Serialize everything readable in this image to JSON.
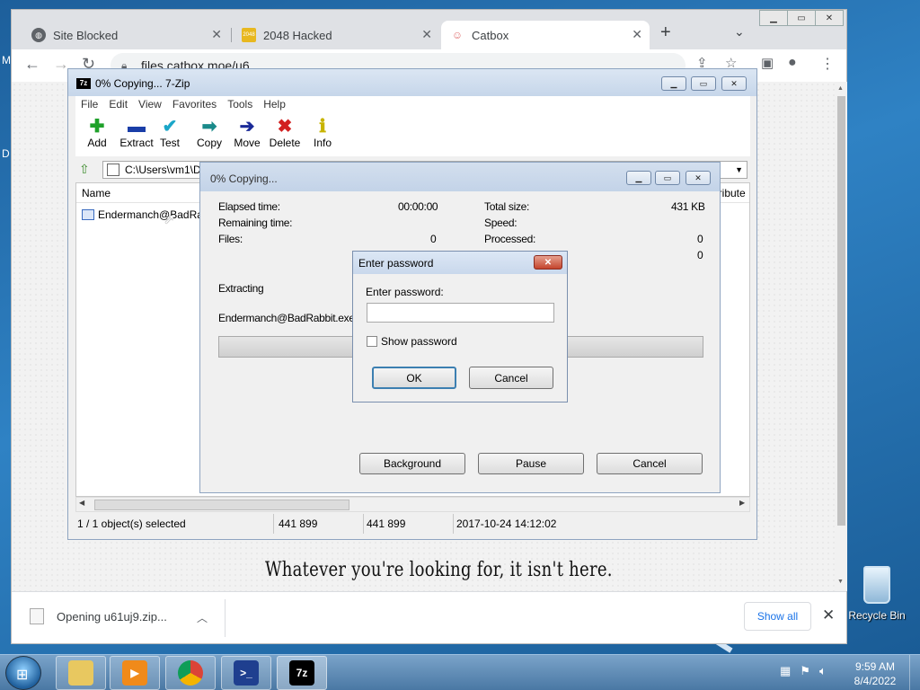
{
  "browser": {
    "tabs": [
      {
        "label": "Site Blocked",
        "icon": "globe-icon"
      },
      {
        "label": "2048 Hacked",
        "icon": "2048-icon",
        "icon_text": "2048"
      },
      {
        "label": "Catbox",
        "icon": "cat-icon",
        "active": true
      }
    ],
    "url": "files.catbox.moe/u6",
    "blocked_message": "Whatever you're looking for, it isn't here.",
    "download": {
      "label": "Opening u61uj9.zip...",
      "show_all": "Show all"
    }
  },
  "zip": {
    "title": "0% Copying... 7-Zip",
    "logo": "7z",
    "menu": [
      "File",
      "Edit",
      "View",
      "Favorites",
      "Tools",
      "Help"
    ],
    "tools": [
      {
        "label": "Add",
        "icon": "plus-icon",
        "color": "#1fa12a"
      },
      {
        "label": "Extract",
        "icon": "minus-icon",
        "color": "#1a3ea8"
      },
      {
        "label": "Test",
        "icon": "check-icon",
        "color": "#1aa6c8"
      },
      {
        "label": "Copy",
        "icon": "double-arrow-icon",
        "color": "#1a8a8a"
      },
      {
        "label": "Move",
        "icon": "arrow-right-icon",
        "color": "#1a2a98"
      },
      {
        "label": "Delete",
        "icon": "x-icon",
        "color": "#d21f1f"
      },
      {
        "label": "Info",
        "icon": "info-icon",
        "color": "#c8b400"
      }
    ],
    "address": "C:\\Users\\vm1\\D",
    "columns": {
      "name": "Name",
      "attributes": "ttribute"
    },
    "file": "Endermanch@BadRab",
    "status": {
      "selected": "1 / 1 object(s) selected",
      "size": "441 899",
      "packed": "441 899",
      "modified": "2017-10-24 14:12:02"
    }
  },
  "copy": {
    "title": "0% Copying...",
    "elapsed_label": "Elapsed time:",
    "elapsed": "00:00:00",
    "remaining_label": "Remaining time:",
    "files_label": "Files:",
    "files": "0",
    "total_label": "Total size:",
    "total": "431 KB",
    "speed_label": "Speed:",
    "processed_label": "Processed:",
    "processed": "0",
    "extra": "0",
    "action": "Extracting",
    "current_file": "Endermanch@BadRabbit.exe",
    "background": "Background",
    "pause": "Pause",
    "cancel": "Cancel"
  },
  "password": {
    "title": "Enter password",
    "label": "Enter password:",
    "value": "",
    "show": "Show password",
    "ok": "OK",
    "cancel": "Cancel"
  },
  "desktop": {
    "recycle_bin": "Recycle Bin",
    "left_letters": [
      "M",
      "D"
    ]
  },
  "taskbar": {
    "time": "9:59 AM",
    "date": "8/4/2022",
    "zip_label": "7z"
  }
}
